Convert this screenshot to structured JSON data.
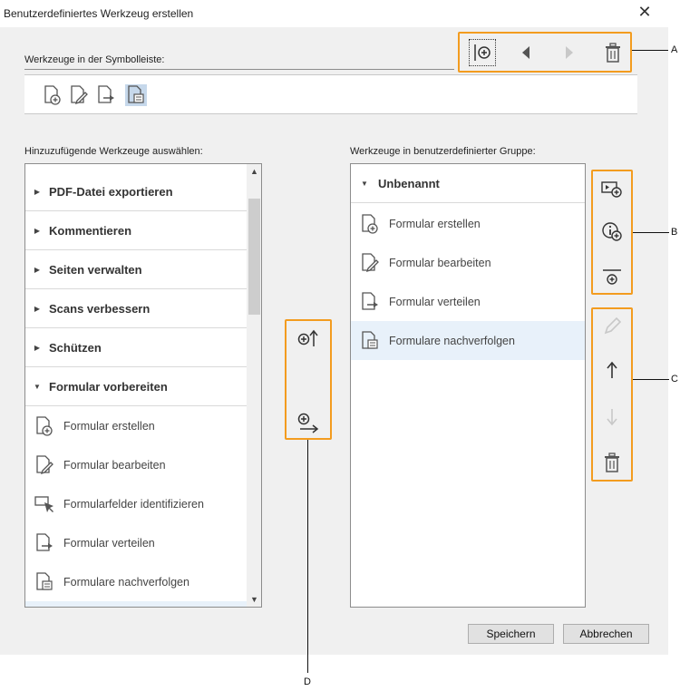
{
  "window": {
    "title": "Benutzerdefiniertes Werkzeug erstellen",
    "close_icon": "close-icon"
  },
  "toolbar_section": {
    "label": "Werkzeuge in der Symbolleiste:",
    "buttons": [
      {
        "name": "add-divider",
        "icon": "divider-add-icon"
      },
      {
        "name": "move-left",
        "icon": "triangle-left-icon"
      },
      {
        "name": "move-right",
        "icon": "triangle-right-icon"
      },
      {
        "name": "delete",
        "icon": "trash-icon"
      }
    ],
    "strip_icons": [
      "form-create-icon",
      "form-edit-icon",
      "form-distribute-icon",
      "form-track-icon"
    ]
  },
  "left_panel": {
    "label": "Hinzuzufügende Werkzeuge auswählen:",
    "groups": [
      {
        "label": "PDF-Datei exportieren",
        "expanded": false
      },
      {
        "label": "Kommentieren",
        "expanded": false
      },
      {
        "label": "Seiten verwalten",
        "expanded": false
      },
      {
        "label": "Scans verbessern",
        "expanded": false
      },
      {
        "label": "Schützen",
        "expanded": false
      },
      {
        "label": "Formular vorbereiten",
        "expanded": true
      }
    ],
    "tools": [
      {
        "label": "Formular erstellen",
        "icon": "form-create-icon"
      },
      {
        "label": "Formular bearbeiten",
        "icon": "form-edit-icon"
      },
      {
        "label": "Formularfelder identifizieren",
        "icon": "form-identify-icon"
      },
      {
        "label": "Formular verteilen",
        "icon": "form-distribute-icon"
      },
      {
        "label": "Formulare nachverfolgen",
        "icon": "form-track-icon"
      }
    ],
    "scroll_up_glyph": "▲",
    "scroll_down_glyph": "▼"
  },
  "middle_controls": [
    {
      "name": "add-to-toolbar",
      "icon": "add-up-icon"
    },
    {
      "name": "add-to-group",
      "icon": "add-right-icon"
    }
  ],
  "right_panel": {
    "label": "Werkzeuge in benutzerdefinierter Gruppe:",
    "group": {
      "label": "Unbenannt",
      "expanded": true
    },
    "tools": [
      {
        "label": "Formular erstellen",
        "icon": "form-create-icon",
        "selected": false
      },
      {
        "label": "Formular bearbeiten",
        "icon": "form-edit-icon",
        "selected": false
      },
      {
        "label": "Formular verteilen",
        "icon": "form-distribute-icon",
        "selected": false
      },
      {
        "label": "Formulare nachverfolgen",
        "icon": "form-track-icon",
        "selected": true
      }
    ]
  },
  "side_group_b": [
    {
      "name": "add-group",
      "icon": "add-group-icon"
    },
    {
      "name": "add-info",
      "icon": "info-add-icon"
    },
    {
      "name": "add-separator",
      "icon": "separator-add-icon"
    }
  ],
  "side_group_c": [
    {
      "name": "edit",
      "icon": "pencil-icon",
      "enabled": false
    },
    {
      "name": "move-up",
      "icon": "arrow-up-icon",
      "enabled": true
    },
    {
      "name": "move-down",
      "icon": "arrow-down-icon",
      "enabled": false
    },
    {
      "name": "delete",
      "icon": "trash-icon",
      "enabled": true
    }
  ],
  "callouts": {
    "a": "A",
    "b": "B",
    "c": "C",
    "d": "D"
  },
  "footer": {
    "save_label": "Speichern",
    "cancel_label": "Abbrechen"
  },
  "colors": {
    "highlight": "#f39c1f",
    "selection": "#c6d8eb",
    "row_selection": "#e8f1fa"
  }
}
